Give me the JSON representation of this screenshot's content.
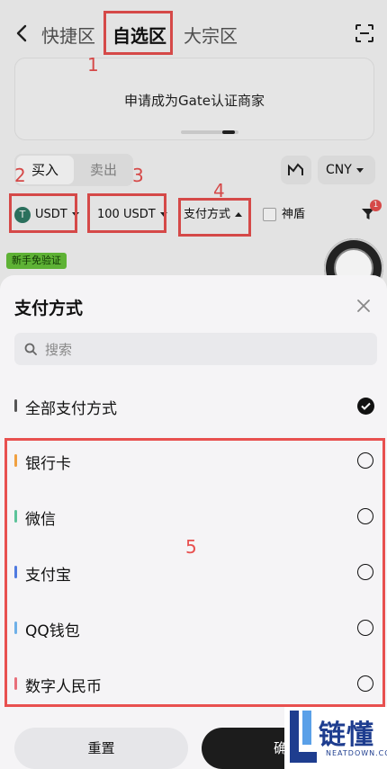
{
  "header": {
    "tabs": [
      {
        "label": "快捷区"
      },
      {
        "label": "自选区",
        "selected": true
      },
      {
        "label": "大宗区"
      }
    ]
  },
  "banner": {
    "text": "申请成为Gate认证商家"
  },
  "trade_side": {
    "buy": "买入",
    "sell": "卖出"
  },
  "currency": {
    "value": "CNY"
  },
  "filters": {
    "coin": "USDT",
    "amount": "100 USDT",
    "payment": "支付方式",
    "shield": "神盾",
    "filter_badge": "1"
  },
  "newbie_tag": "新手免验证",
  "annotations": [
    "1",
    "2",
    "3",
    "4",
    "5"
  ],
  "sheet": {
    "title": "支付方式",
    "search_placeholder": "搜索",
    "options": [
      {
        "label": "全部支付方式",
        "bar_color": "#555555",
        "selected": true
      },
      {
        "label": "银行卡",
        "bar_color": "#f0a040",
        "selected": false
      },
      {
        "label": "微信",
        "bar_color": "#5cc39a",
        "selected": false
      },
      {
        "label": "支付宝",
        "bar_color": "#4f7ae0",
        "selected": false
      },
      {
        "label": "QQ钱包",
        "bar_color": "#6fb0e8",
        "selected": false
      },
      {
        "label": "数字人民币",
        "bar_color": "#e86f7a",
        "selected": false
      }
    ],
    "reset": "重置",
    "confirm": "确"
  },
  "watermark": {
    "text": "链懂",
    "sub": "NEATDOWN.COM"
  },
  "colors": {
    "annotation": "#e8504f",
    "accent_dark": "#1c1c1c"
  }
}
